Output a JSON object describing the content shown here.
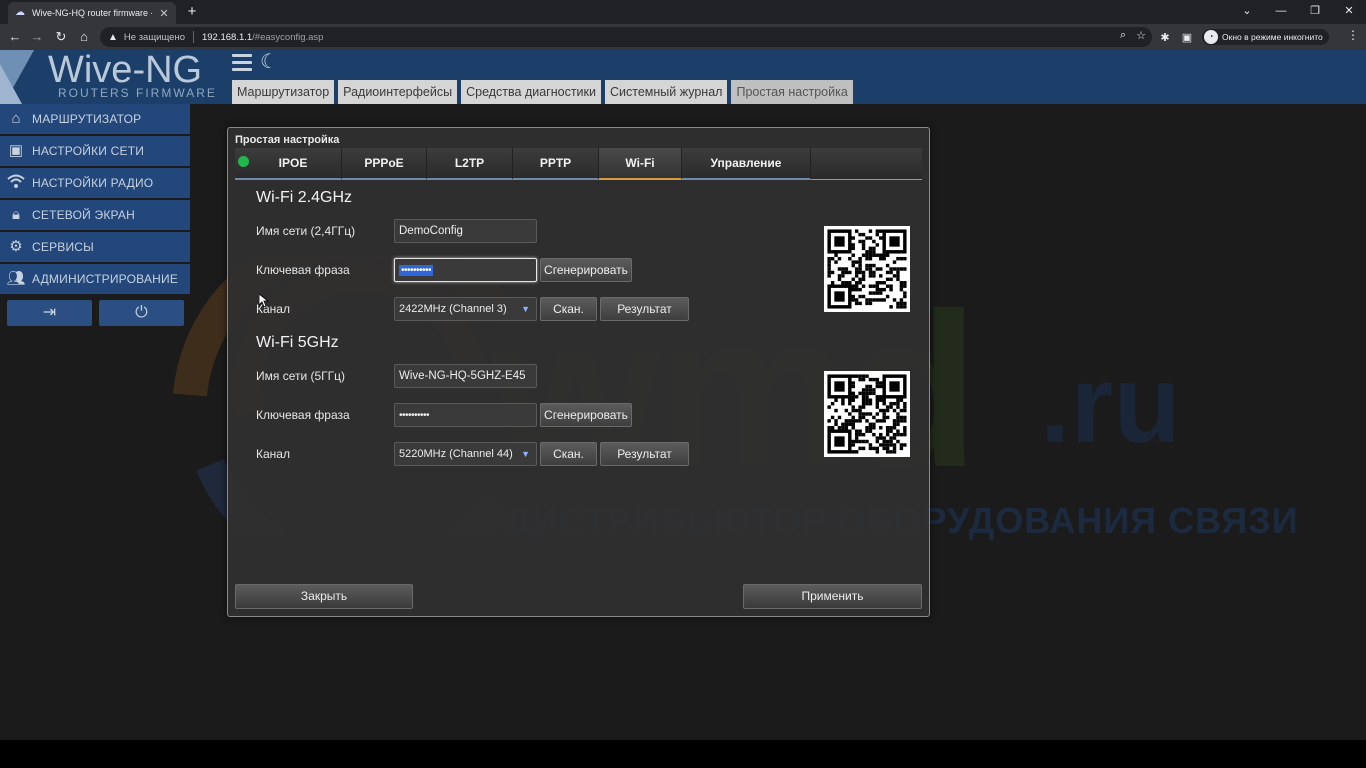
{
  "browser": {
    "tab_title": "Wive-NG-HQ router firmware - I",
    "not_secure": "Не защищено",
    "url_host": "192.168.1.1",
    "url_path": "/#easyconfig.asp",
    "incognito_label": "Окно в режиме инкогнито"
  },
  "header": {
    "logo_main": "Wive-NG",
    "logo_sub": "ROUTERS FIRMWARE",
    "tabs": [
      {
        "label": "Маршрутизатор"
      },
      {
        "label": "Радиоинтерфейсы"
      },
      {
        "label": "Средства диагностики"
      },
      {
        "label": "Системный журнал"
      },
      {
        "label": "Простая настройка"
      }
    ]
  },
  "sidebar": {
    "items": [
      {
        "label": "МАРШРУТИЗАТОР",
        "icon": "home-icon"
      },
      {
        "label": "НАСТРОЙКИ СЕТИ",
        "icon": "network-port-icon"
      },
      {
        "label": "НАСТРОЙКИ РАДИО",
        "icon": "wifi-icon"
      },
      {
        "label": "СЕТЕВОЙ ЭКРАН",
        "icon": "lock-icon"
      },
      {
        "label": "СЕРВИСЫ",
        "icon": "gear-icon"
      },
      {
        "label": "АДМИНИСТРИРОВАНИЕ",
        "icon": "users-icon"
      }
    ],
    "buttons": [
      {
        "name": "logout-button",
        "icon": "logout-icon"
      },
      {
        "name": "power-button",
        "icon": "power-icon"
      }
    ]
  },
  "watermark": {
    "brand": "wmd",
    "tld": ".ru",
    "slogan": "ДИСТРИБЬЮТОР ОБОРУДОВАНИЯ СВЯЗИ"
  },
  "dialog": {
    "title": "Простая настройка",
    "status_color": "#1fb84a",
    "tabs": [
      {
        "label": "IPOE"
      },
      {
        "label": "PPPoE"
      },
      {
        "label": "L2TP"
      },
      {
        "label": "PPTP"
      },
      {
        "label": "Wi-Fi",
        "active": true
      },
      {
        "label": "Управление"
      }
    ],
    "wifi24": {
      "title": "Wi-Fi 2.4GHz",
      "ssid_label": "Имя сети (2,4ГГц)",
      "ssid_value": "DemoConfig",
      "key_label": "Ключевая фраза",
      "key_value": "••••••••••",
      "generate_label": "Сгенерировать",
      "channel_label": "Канал",
      "channel_value": "2422MHz (Channel 3)",
      "scan_label": "Скан.",
      "result_label": "Результат"
    },
    "wifi5": {
      "title": "Wi-Fi 5GHz",
      "ssid_label": "Имя сети (5ГГц)",
      "ssid_value": "Wive-NG-HQ-5GHZ-E45",
      "key_label": "Ключевая фраза",
      "key_value": "••••••••••",
      "generate_label": "Сгенерировать",
      "channel_label": "Канал",
      "channel_value": "5220MHz (Channel 44)",
      "scan_label": "Скан.",
      "result_label": "Результат"
    },
    "close_label": "Закрыть",
    "apply_label": "Применить"
  }
}
